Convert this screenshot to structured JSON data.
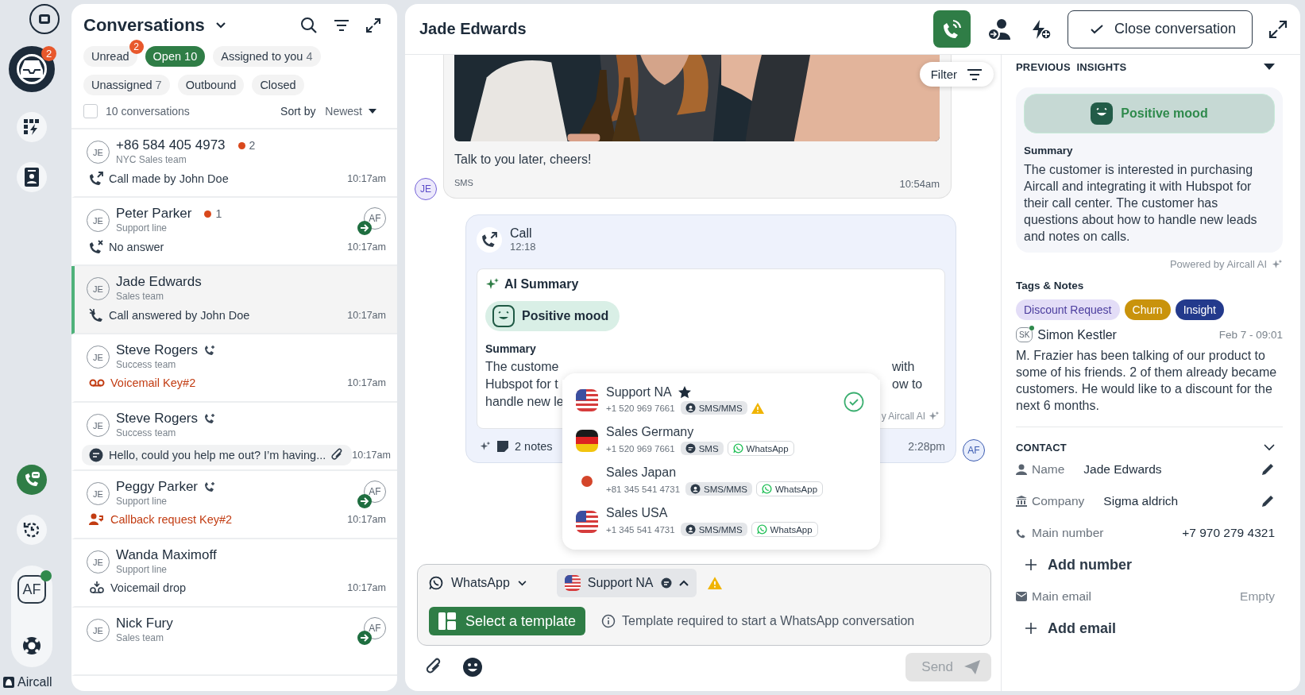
{
  "rail": {
    "inbox_badge": "2",
    "user_initials": "AF",
    "user_online": true,
    "brand": "Aircall"
  },
  "conversations": {
    "title": "Conversations",
    "filters": [
      {
        "label": "Unread",
        "badge": "2",
        "selected": false
      },
      {
        "label": "Open",
        "count": "10",
        "selected": true
      },
      {
        "label": "Assigned to you",
        "count": "4",
        "selected": false
      },
      {
        "label": "Unassigned",
        "count": "7",
        "selected": false
      },
      {
        "label": "Outbound",
        "selected": false
      },
      {
        "label": "Closed",
        "selected": false
      }
    ],
    "select_all_checked": false,
    "count_label": "10 conversations",
    "sort_label": "Sort by",
    "sort_value": "Newest",
    "items": [
      {
        "initials": "JE",
        "name": "+86 584 405 4973",
        "team": "NYC Sales team",
        "unread": "2",
        "phone_badge": false,
        "kind": "outgoing",
        "activity": "Call made by John Doe",
        "time": "10:17am",
        "selected": false
      },
      {
        "initials": "JE",
        "name": "Peter Parker",
        "team": "Support line",
        "unread": "1",
        "phone_badge": false,
        "assignee": "AF",
        "kind": "missed",
        "activity": "No answer",
        "time": "10:17am",
        "selected": false
      },
      {
        "initials": "JE",
        "name": "Jade Edwards",
        "team": "Sales team",
        "phone_badge": false,
        "kind": "answered",
        "activity": "Call answered by John Doe",
        "time": "10:17am",
        "selected": true
      },
      {
        "initials": "JE",
        "name": "Steve Rogers",
        "team": "Success team",
        "phone_badge": true,
        "kind": "voicemail",
        "activity": "Voicemail Key#2",
        "time": "10:17am",
        "selected": false
      },
      {
        "initials": "JE",
        "name": "Steve Rogers",
        "team": "Success team",
        "phone_badge": true,
        "kind": "message",
        "activity": "Hello, could you help me out? I’m having...",
        "time": "10:17am",
        "selected": false
      },
      {
        "initials": "JE",
        "name": "Peggy Parker",
        "team": "Support line",
        "phone_badge": true,
        "assignee": "AF",
        "kind": "callback",
        "activity": "Callback request Key#2",
        "time": "10:17am",
        "selected": false
      },
      {
        "initials": "JE",
        "name": "Wanda Maximoff",
        "team": "Support line",
        "phone_badge": false,
        "kind": "drop",
        "activity": "Voicemail drop",
        "time": "10:17am",
        "selected": false
      },
      {
        "initials": "JE",
        "name": "Nick Fury",
        "team": "Sales team",
        "phone_badge": false,
        "assignee": "AF",
        "selected": false
      }
    ]
  },
  "chat": {
    "title": "Jade Edwards",
    "close_button": "Close conversation",
    "filter": "Filter",
    "message": {
      "kind": "picture",
      "text": "Talk to you later, cheers!",
      "channel": "SMS",
      "time": "10:54am",
      "avatar": "JE"
    },
    "call": {
      "title": "Call",
      "duration": "12:18",
      "ai_title": "AI Summary",
      "mood": "Positive mood",
      "summary_label": "Summary",
      "left_lines": [
        "The custome",
        "Hubspot for t",
        "handle new le"
      ],
      "right_lines": [
        "with",
        "ow to"
      ],
      "powered": "y Aircall AI",
      "notes": "2 notes",
      "time": "2:28pm",
      "avatar": "AF"
    },
    "lines_menu": [
      {
        "name": "Support NA",
        "number": "+1 520 969 7661",
        "kind": "us",
        "starred": true,
        "warning": true,
        "selected": true,
        "channels": [
          {
            "kind": "mms",
            "label": "SMS/MMS"
          }
        ]
      },
      {
        "name": "Sales Germany",
        "number": "+1 520 969 7661",
        "kind": "de",
        "starred": false,
        "warning": false,
        "selected": false,
        "channels": [
          {
            "kind": "sms",
            "label": "SMS"
          },
          {
            "kind": "whatsapp",
            "label": "WhatsApp"
          }
        ]
      },
      {
        "name": "Sales Japan",
        "number": "+81 345 541 4731",
        "kind": "jp",
        "starred": false,
        "warning": false,
        "selected": false,
        "channels": [
          {
            "kind": "mms",
            "label": "SMS/MMS"
          },
          {
            "kind": "whatsapp",
            "label": "WhatsApp"
          }
        ]
      },
      {
        "name": "Sales USA",
        "number": "+1 345 541 4731",
        "kind": "us",
        "starred": false,
        "warning": false,
        "selected": false,
        "channels": [
          {
            "kind": "mms",
            "label": "SMS/MMS"
          },
          {
            "kind": "whatsapp",
            "label": "WhatsApp"
          }
        ]
      }
    ],
    "composer": {
      "channel": "WhatsApp",
      "line": {
        "kind": "us",
        "label": "Support NA"
      },
      "warning": true,
      "template_button": "Select a template",
      "hint": "Template required to start a WhatsApp conversation",
      "send": "Send",
      "send_disabled": true
    }
  },
  "details": {
    "insights_title": "PREVIOUS  INSIGHTS",
    "mood": "Positive mood",
    "summary_label": "Summary",
    "summary": "The customer is interested in purchasing Aircall and integrating it with Hubspot for their call center. The customer has questions about how to handle new leads and notes on calls.",
    "powered": "Powered by Aircall AI",
    "tags_title": "Tags & Notes",
    "tags": [
      {
        "label": "Discount Request",
        "color": "#e3ddf7"
      },
      {
        "label": "Churn",
        "color": "#c9930c"
      },
      {
        "label": "Insight",
        "color": "#233a8c"
      }
    ],
    "note": {
      "initials": "SK",
      "author": "Simon Kestler",
      "author_online": true,
      "date": "Feb 7 - 09:01",
      "text": "M. Frazier has been talking of our product to some of his friends. 2 of them already became customers. He would like to a discount for the next 6 months."
    },
    "contact_title": "CONTACT",
    "contact_fields": [
      {
        "kind": "name",
        "label": "Name",
        "value": "Jade Edwards",
        "editable": true
      },
      {
        "kind": "company",
        "label": "Company",
        "value": "Sigma aldrich",
        "editable": true
      },
      {
        "kind": "phone",
        "label": "Main number",
        "value": "+7 970 279 4321",
        "editable": false
      },
      {
        "kind": "add",
        "label": "Add number"
      },
      {
        "kind": "email",
        "label": "Main email",
        "value": "Empty",
        "editable": false,
        "empty": true
      },
      {
        "kind": "add",
        "label": "Add email"
      }
    ]
  }
}
